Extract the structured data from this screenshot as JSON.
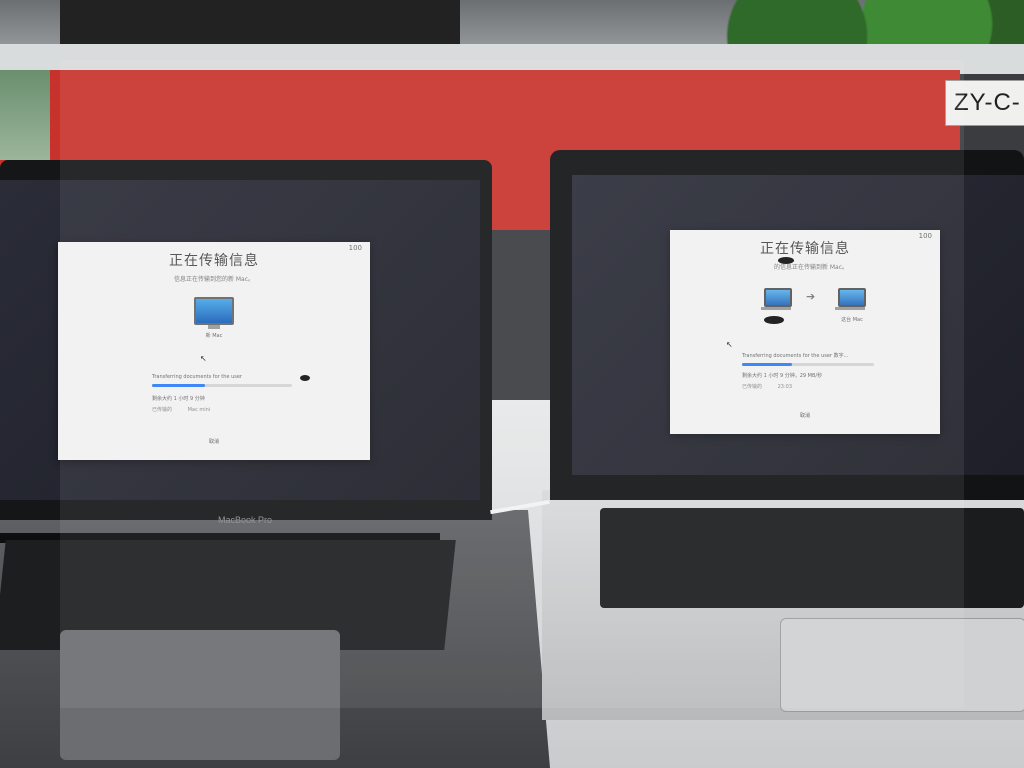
{
  "scene": {
    "background_label": "ZY-C-",
    "left_laptop_brand": "MacBook Pro"
  },
  "left_window": {
    "title": "正在传输信息",
    "subtitle": "信息正在传输到您的新 Mac。",
    "device_label": "新 Mac",
    "status_text": "Transferring documents for the user",
    "eta_text": "剩余大约 1 小时 9 分钟",
    "detail_left": "已传输的",
    "detail_right": "Mac mini",
    "cancel_label": "取消",
    "progress": 0.38,
    "close_label": "100"
  },
  "right_window": {
    "title": "正在传输信息",
    "subtitle": "的信息正在传输到新 Mac。",
    "target_label": "这台 Mac",
    "status_text": "Transferring documents for the user 数字...",
    "eta_text": "剩余大约 1 小时 9 分钟，29 MB/秒",
    "detail_left": "已传输的",
    "detail_right": "23:03",
    "cancel_label": "取消",
    "progress": 0.38,
    "close_label": "100"
  }
}
